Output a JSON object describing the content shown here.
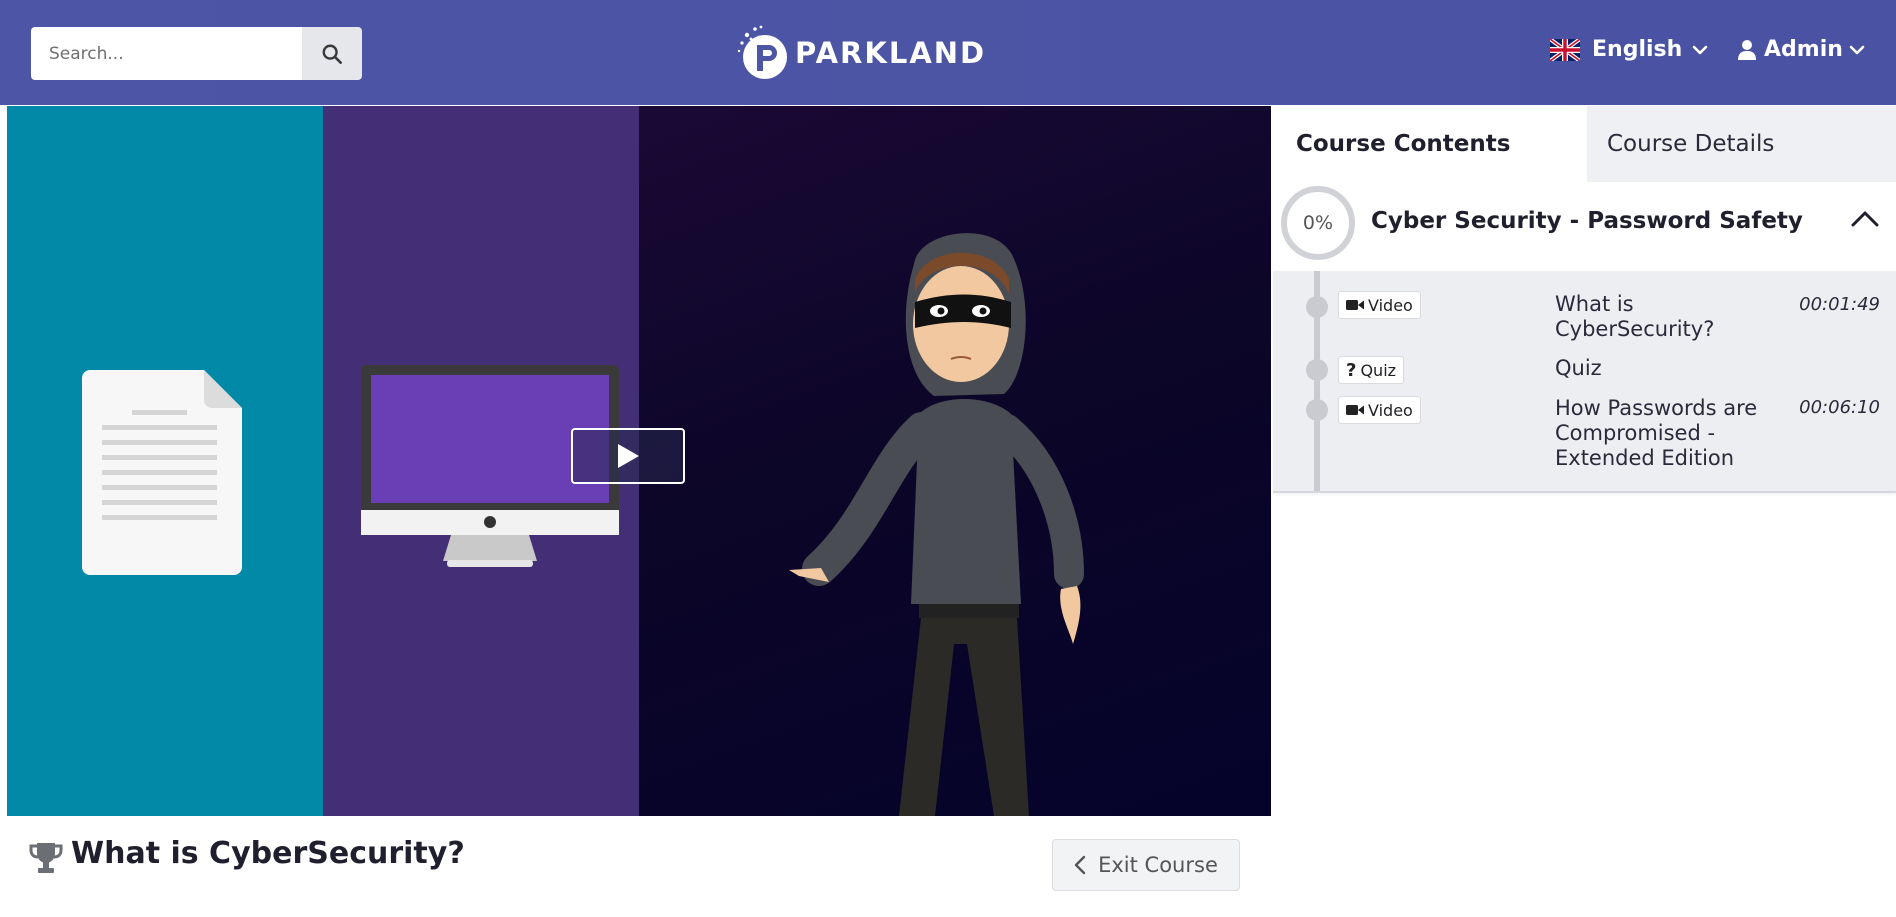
{
  "header": {
    "search": {
      "placeholder": "Search..."
    },
    "brand": "PARKLAND",
    "language": "English",
    "user": "Admin"
  },
  "player": {
    "play_icon": "play-icon"
  },
  "lesson": {
    "title": "What is CyberSecurity?",
    "exit_label": "Exit Course"
  },
  "sidebar": {
    "tabs": [
      {
        "label": "Course Contents",
        "active": true
      },
      {
        "label": "Course Details",
        "active": false
      }
    ],
    "section": {
      "progress": "0%",
      "title": "Cyber Security - Password Safety",
      "items": [
        {
          "type": "Video",
          "icon": "video-camera-icon",
          "title": "What is CyberSecurity?",
          "duration": "00:01:49"
        },
        {
          "type": "Quiz",
          "icon": "question-icon",
          "title": "Quiz",
          "duration": ""
        },
        {
          "type": "Video",
          "icon": "video-camera-icon",
          "title": "How Passwords are Compromised - Extended Edition",
          "duration": "00:06:10"
        }
      ]
    }
  },
  "colors": {
    "header_bg": "#4d55a6",
    "teal_panel": "#0389a8",
    "purple_panel": "#432f75",
    "dark_panel": "#0c0628"
  }
}
